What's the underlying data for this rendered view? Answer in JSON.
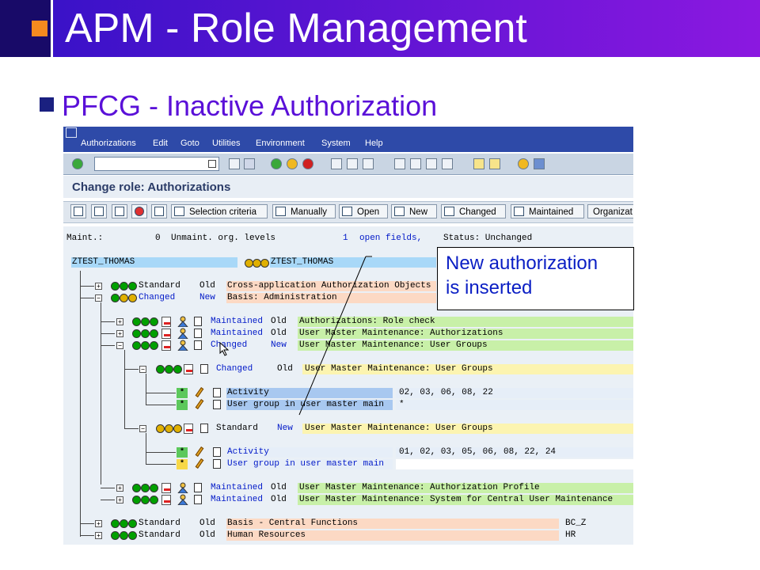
{
  "slide": {
    "title": "APM - Role Management",
    "subtitle": "PFCG - Inactive Authorization"
  },
  "sap": {
    "menu": [
      "Authorizations",
      "Edit",
      "Goto",
      "Utilities",
      "Environment",
      "System",
      "Help"
    ],
    "heading": "Change role: Authorizations",
    "buttons": {
      "selection_criteria": "Selection criteria",
      "manually": "Manually",
      "open": "Open",
      "new": "New",
      "changed": "Changed",
      "maintained": "Maintained",
      "organiz": "Organizat"
    },
    "status_line": {
      "maint_label": "Maint.:",
      "maint_value": "0",
      "unmaint_label": "Unmaint. org. levels",
      "open_value": "1",
      "open_label": "open fields,",
      "status_label": "Status: Unchanged"
    },
    "role": {
      "name": "ZTEST_THOMAS",
      "name2": "ZTEST_THOMAS"
    },
    "tree": {
      "r1": {
        "status": "Standard",
        "age": "Old",
        "text": "Cross-application Authorization Objects"
      },
      "r2": {
        "status": "Changed",
        "age": "New",
        "text": "Basis: Administration"
      },
      "r3": {
        "status": "Maintained",
        "age": "Old",
        "text": "Authorizations: Role check"
      },
      "r4": {
        "status": "Maintained",
        "age": "Old",
        "text": "User Master Maintenance: Authorizations"
      },
      "r5": {
        "status": "Changed",
        "age": "New",
        "text": "User Master Maintenance: User Groups"
      },
      "r6": {
        "status": "Changed",
        "age": "Old",
        "text": "User Master Maintenance: User Groups"
      },
      "f1": {
        "name": "Activity",
        "value": "02, 03, 06, 08, 22"
      },
      "f2": {
        "name": "User group in user master main",
        "value": "*"
      },
      "r7": {
        "status": "Standard",
        "age": "New",
        "text": "User Master Maintenance: User Groups"
      },
      "f3": {
        "name": "Activity",
        "value": "01, 02, 03, 05, 06, 08, 22, 24"
      },
      "f4": {
        "name": "User group in user master main",
        "value": ""
      },
      "r8": {
        "status": "Maintained",
        "age": "Old",
        "text": "User Master Maintenance: Authorization Profile"
      },
      "r9": {
        "status": "Maintained",
        "age": "Old",
        "text": "User Master Maintenance: System for Central User Maintenance"
      },
      "r10": {
        "status": "Standard",
        "age": "Old",
        "text": "Basis - Central Functions",
        "code": "BC_Z"
      },
      "r11": {
        "status": "Standard",
        "age": "Old",
        "text": "Human Resources",
        "code": "HR"
      },
      "star": "*"
    },
    "callout": "New authorization\nis inserted"
  }
}
